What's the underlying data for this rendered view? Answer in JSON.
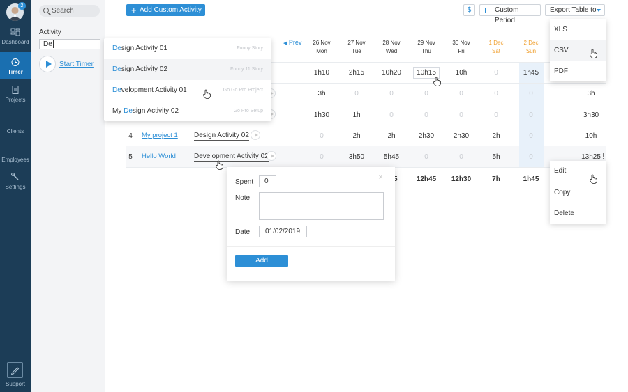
{
  "user": {
    "badge_count": "2"
  },
  "sidebar": {
    "items": [
      {
        "label": "Dashboard"
      },
      {
        "label": "Timer"
      },
      {
        "label": "Projects"
      },
      {
        "label": "Clients"
      },
      {
        "label": "Employees"
      },
      {
        "label": "Settings"
      }
    ],
    "support_label": "Support"
  },
  "left_panel": {
    "search_placeholder": "Search",
    "activity_label": "Activity",
    "activity_value": "De",
    "start_timer": "Start Timer"
  },
  "toolbar": {
    "add_activity": "Add Custom Activity",
    "currency": "$",
    "period": "Custom Period",
    "export": "Export Table to"
  },
  "export_menu": [
    "XLS",
    "CSV",
    "PDF"
  ],
  "table": {
    "prev": "Prev",
    "days": [
      {
        "date": "26 Nov",
        "day": "Mon"
      },
      {
        "date": "27 Nov",
        "day": "Tue"
      },
      {
        "date": "28 Nov",
        "day": "Wed"
      },
      {
        "date": "29 Nov",
        "day": "Thu"
      },
      {
        "date": "30 Nov",
        "day": "Fri"
      },
      {
        "date": "1 Dec",
        "day": "Sat"
      },
      {
        "date": "2 Dec",
        "day": "Sun"
      }
    ],
    "rows": [
      {
        "num": "",
        "project": "",
        "activity": "",
        "cells": [
          "1h10",
          "2h15",
          "10h20",
          "10h15",
          "10h",
          "0",
          "1h45"
        ],
        "total": ""
      },
      {
        "num": "",
        "project": "",
        "activity": "",
        "cells": [
          "3h",
          "0",
          "0",
          "0",
          "0",
          "0",
          "0"
        ],
        "total": "3h"
      },
      {
        "num": "",
        "project": "",
        "activity": "",
        "cells": [
          "1h30",
          "1h",
          "0",
          "0",
          "0",
          "0",
          "0"
        ],
        "total": "3h30"
      },
      {
        "num": "4",
        "project": "My project 1",
        "activity": "Design Activity 02",
        "cells": [
          "0",
          "2h",
          "2h",
          "2h30",
          "2h30",
          "2h",
          "0"
        ],
        "total": "10h"
      },
      {
        "num": "5",
        "project": "Hello World",
        "activity": "Development Activity 02",
        "cells": [
          "0",
          "3h50",
          "5h45",
          "0",
          "0",
          "5h",
          "0"
        ],
        "total": "13h25"
      }
    ],
    "totals": [
      "05",
      "12h45",
      "12h30",
      "7h",
      "1h45"
    ]
  },
  "dropdown": [
    {
      "match": "De",
      "rest": "sign Activity 01",
      "prefix": "",
      "sub": "Funny Story"
    },
    {
      "match": "De",
      "rest": "sign Activity 02",
      "prefix": "",
      "sub": "Funny 11 Story"
    },
    {
      "match": "De",
      "rest": "velopment Activity 01",
      "prefix": "",
      "sub": "Go Go Pro Project"
    },
    {
      "match": "De",
      "rest": "sign Activity 02",
      "prefix": "My ",
      "sub": "Go Pro Setup"
    }
  ],
  "context_menu": [
    "Edit",
    "Copy",
    "Delete"
  ],
  "modal": {
    "spent_label": "Spent",
    "spent_value": "0",
    "note_label": "Note",
    "note_value": "",
    "date_label": "Date",
    "date_value": "01/02/2019",
    "add_label": "Add",
    "close": "×"
  }
}
